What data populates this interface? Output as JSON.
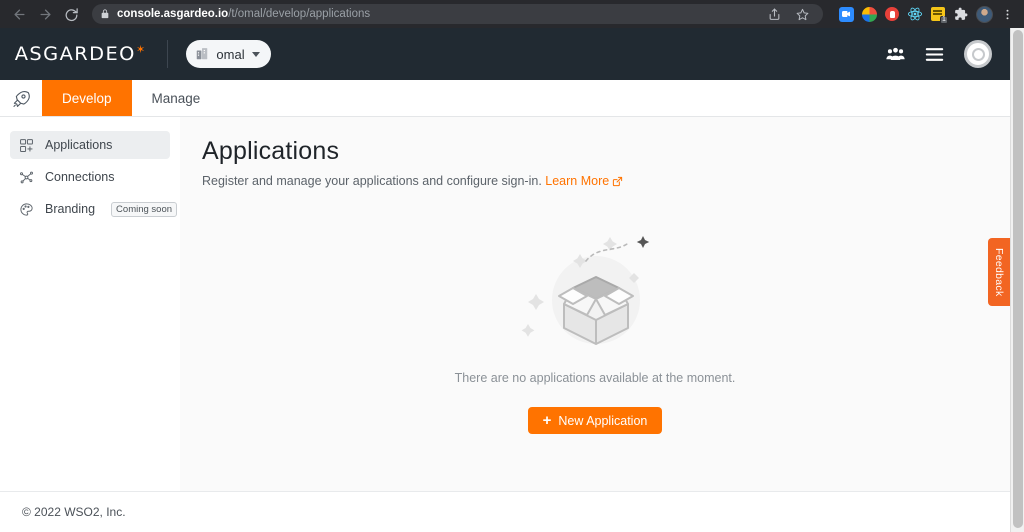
{
  "browser": {
    "back_icon": "back-arrow-icon",
    "forward_icon": "forward-arrow-icon",
    "reload_icon": "reload-icon",
    "lock_icon": "lock-icon",
    "url_domain": "console.asgardeo.io",
    "url_path": "/t/omal/develop/applications",
    "share_icon": "share-icon",
    "bookmark_icon": "star-icon",
    "extensions": [
      {
        "name": "zoom-extension-icon",
        "badge": ""
      },
      {
        "name": "photos-extension-icon",
        "badge": ""
      },
      {
        "name": "record-extension-icon",
        "badge": ""
      },
      {
        "name": "react-devtools-icon",
        "badge": ""
      },
      {
        "name": "notes-extension-icon",
        "badge": "1"
      },
      {
        "name": "puzzle-extensions-icon",
        "badge": ""
      }
    ],
    "profile_icon": "profile-avatar-icon",
    "menu_icon": "kebab-menu-icon"
  },
  "header": {
    "logo_text": "ASGARDEO",
    "org_name": "omal",
    "org_icon": "building-icon",
    "org_caret_icon": "chevron-down-icon",
    "users_icon": "users-icon",
    "hamburger_icon": "hamburger-menu-icon",
    "avatar_icon": "user-avatar-icon"
  },
  "tabbar": {
    "rocket_icon": "rocket-icon",
    "tabs": [
      {
        "label": "Develop",
        "active": true
      },
      {
        "label": "Manage",
        "active": false
      }
    ]
  },
  "sidebar": {
    "items": [
      {
        "label": "Applications",
        "icon": "applications-grid-icon",
        "active": true,
        "badge": ""
      },
      {
        "label": "Connections",
        "icon": "connections-nodes-icon",
        "active": false,
        "badge": ""
      },
      {
        "label": "Branding",
        "icon": "branding-palette-icon",
        "active": false,
        "badge": "Coming soon"
      }
    ]
  },
  "main": {
    "title": "Applications",
    "subtitle": "Register and manage your applications and configure sign-in.",
    "learn_more": "Learn More",
    "learn_more_icon": "external-link-icon",
    "empty_illustration": "empty-box-illustration",
    "empty_message": "There are no applications available at the moment.",
    "new_application_button": "New Application",
    "new_application_icon": "plus-icon"
  },
  "feedback": {
    "label": "Feedback"
  },
  "footer": {
    "copyright": "© 2022 WSO2, Inc."
  },
  "colors": {
    "accent_orange": "#ff7300",
    "feedback_orange": "#f26522",
    "header_dark": "#212a32",
    "browser_dark": "#28292d",
    "page_bg": "#fafafa"
  }
}
